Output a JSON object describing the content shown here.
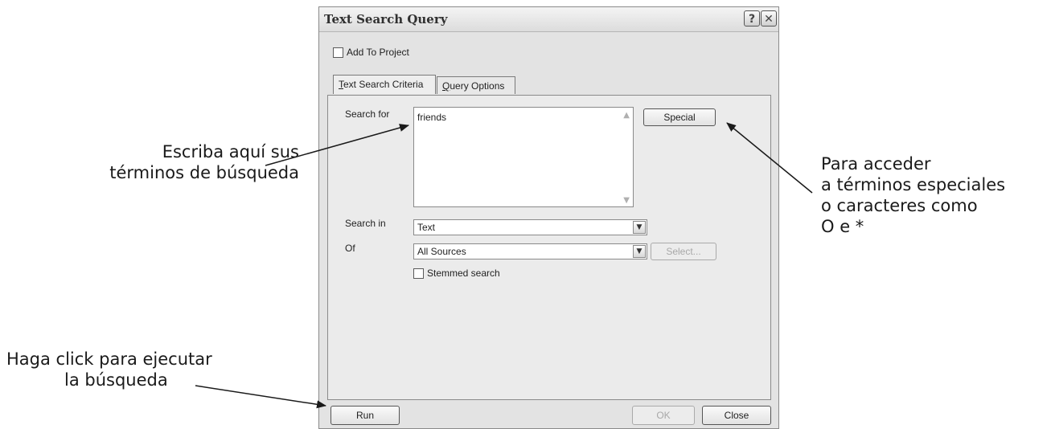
{
  "dialog": {
    "title": "Text Search Query",
    "help_glyph": "?",
    "close_glyph": "✕",
    "add_to_project_label": "Add To Project",
    "tabs": [
      {
        "label_prefix": "",
        "label_mnemonic": "T",
        "label_rest": "ext Search Criteria",
        "active": true
      },
      {
        "label_prefix": "",
        "label_mnemonic": "Q",
        "label_rest": "uery Options",
        "active": false
      }
    ],
    "search_for_label": "Search for",
    "search_for_value": "friends",
    "special_button": "Special",
    "search_in_label": "Search in",
    "search_in_value": "Text",
    "of_label": "Of",
    "of_value": "All Sources",
    "select_button": "Select...",
    "stemmed_search_label": "Stemmed search",
    "run_button": "Run",
    "ok_button": "OK",
    "close_button": "Close"
  },
  "annotations": {
    "left_top_line1": "Escriba aquí sus",
    "left_top_line2": "términos de búsqueda",
    "left_bottom_line1": "Haga click para ejecutar",
    "left_bottom_line2": "la búsqueda",
    "right_line1": "Para acceder",
    "right_line2": "a términos especiales",
    "right_line3": "o caracteres como",
    "right_line4": "O e *"
  }
}
